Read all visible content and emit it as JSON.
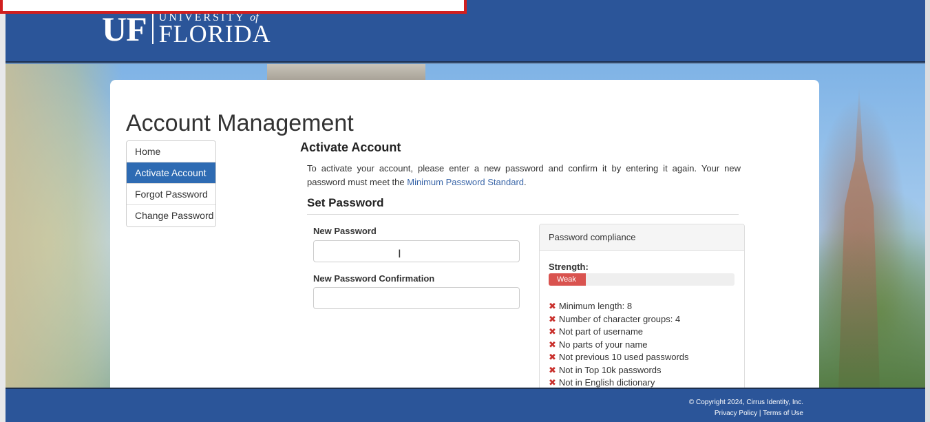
{
  "header": {
    "logo_uf": "UF",
    "logo_university": "UNIVERSITY",
    "logo_of": "of",
    "logo_florida": "FLORIDA"
  },
  "page": {
    "title": "Account Management"
  },
  "nav": {
    "items": [
      {
        "label": "Home"
      },
      {
        "label": "Activate Account"
      },
      {
        "label": "Forgot Password"
      },
      {
        "label": "Change Password"
      }
    ]
  },
  "content": {
    "heading": "Activate Account",
    "description_prefix": "To activate your account, please enter a new password and confirm it by entering it again. Your new password must meet the ",
    "description_link": "Minimum Password Standard",
    "description_suffix": ".",
    "set_password_heading": "Set Password"
  },
  "form": {
    "new_password_label": "New Password",
    "new_password_value": "",
    "confirm_label": "New Password Confirmation",
    "confirm_value": ""
  },
  "compliance": {
    "title": "Password compliance",
    "strength_label": "Strength:",
    "strength_text": "Weak",
    "strength_fraction": 0.2,
    "rules": [
      "Minimum length: 8",
      "Number of character groups: 4",
      "Not part of username",
      "No parts of your name",
      "Not previous 10 used passwords",
      "Not in Top 10k passwords",
      "Not in English dictionary"
    ]
  },
  "footer": {
    "copyright": "© Copyright 2024, Cirrus Identity, Inc.",
    "privacy": "Privacy Policy",
    "separator": "|",
    "terms": "Terms of Use"
  },
  "colors": {
    "brand_blue": "#2b5599",
    "nav_active": "#2e6bb3",
    "weak": "#d9534f"
  }
}
